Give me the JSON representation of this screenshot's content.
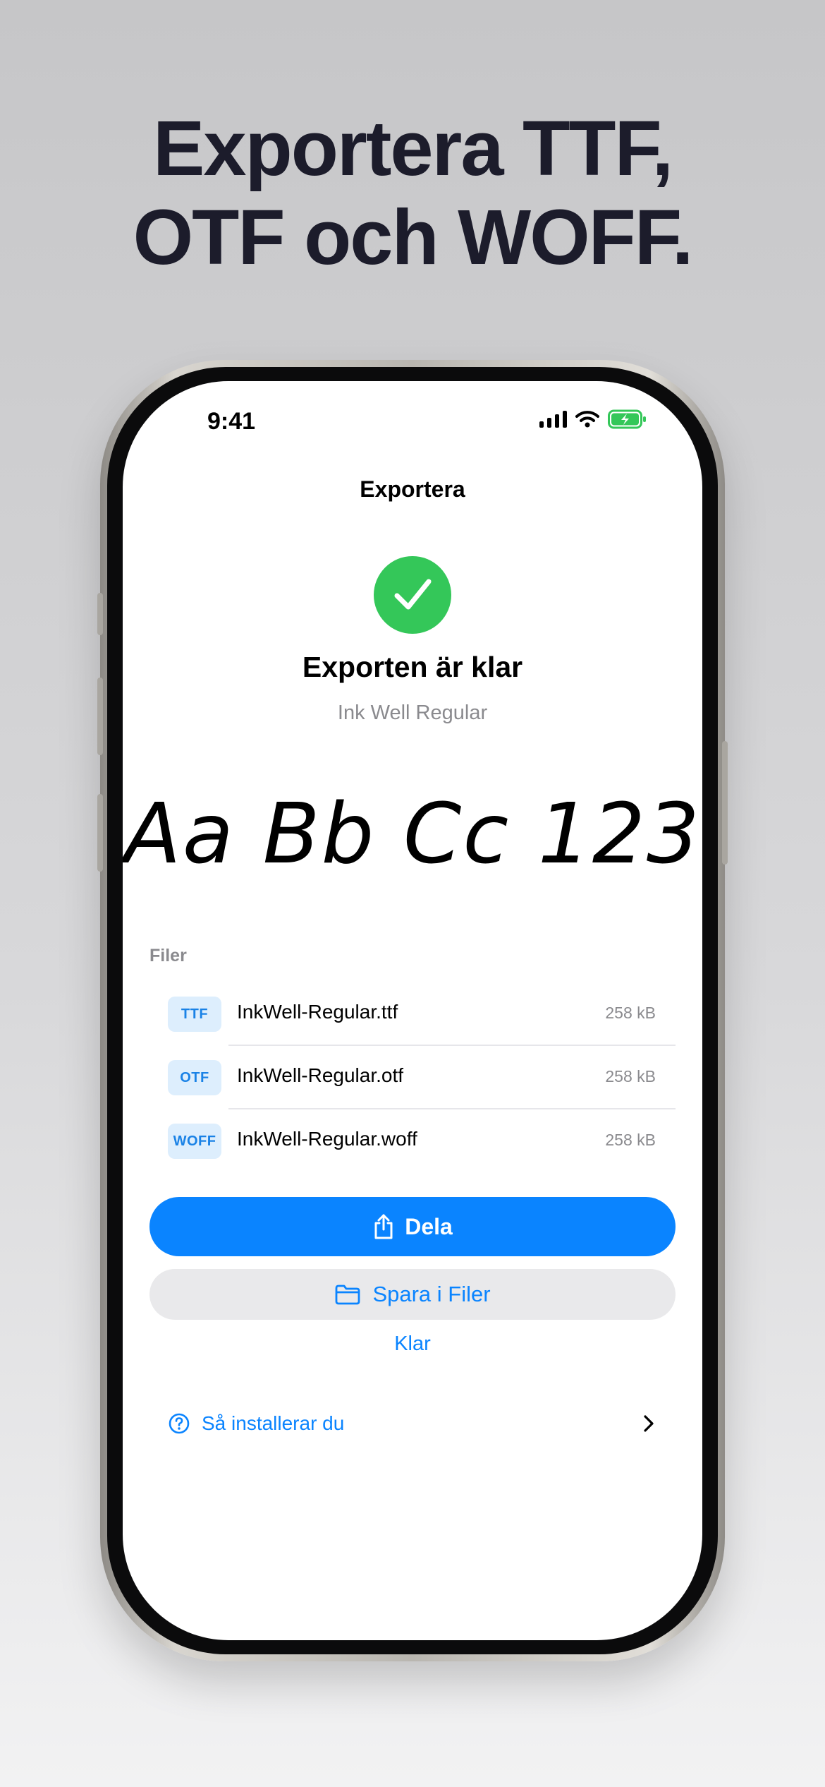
{
  "headline": {
    "line1": "Exportera TTF,",
    "line2": "OTF och WOFF."
  },
  "status_bar": {
    "time": "9:41",
    "icons": [
      "cellular-signal-icon",
      "wifi-icon",
      "battery-charging-icon"
    ]
  },
  "screen": {
    "nav_title": "Exportera",
    "success_icon": "checkmark-circle-icon",
    "title": "Exporten är klar",
    "font_name": "Ink Well Regular",
    "sample_text": "Aa Bb Cc 123",
    "files_section_label": "Filer",
    "files": [
      {
        "badge": "TTF",
        "name": "InkWell-Regular.ttf",
        "size": "258 kB"
      },
      {
        "badge": "OTF",
        "name": "InkWell-Regular.otf",
        "size": "258 kB"
      },
      {
        "badge": "WOFF",
        "name": "InkWell-Regular.woff",
        "size": "258 kB"
      }
    ],
    "share_button": {
      "label": "Dela",
      "icon": "share-icon"
    },
    "save_files_button": {
      "label": "Spara i Filer",
      "icon": "folder-icon"
    },
    "done_button": {
      "label": "Klar"
    },
    "howto": {
      "label": "Så installerar du",
      "icon": "question-circle-icon",
      "chevron": "chevron-right-icon"
    }
  },
  "colors": {
    "accent": "#0a84ff",
    "success": "#34c759",
    "headline": "#1c1c2b",
    "badge_bg": "#ddeefd"
  }
}
